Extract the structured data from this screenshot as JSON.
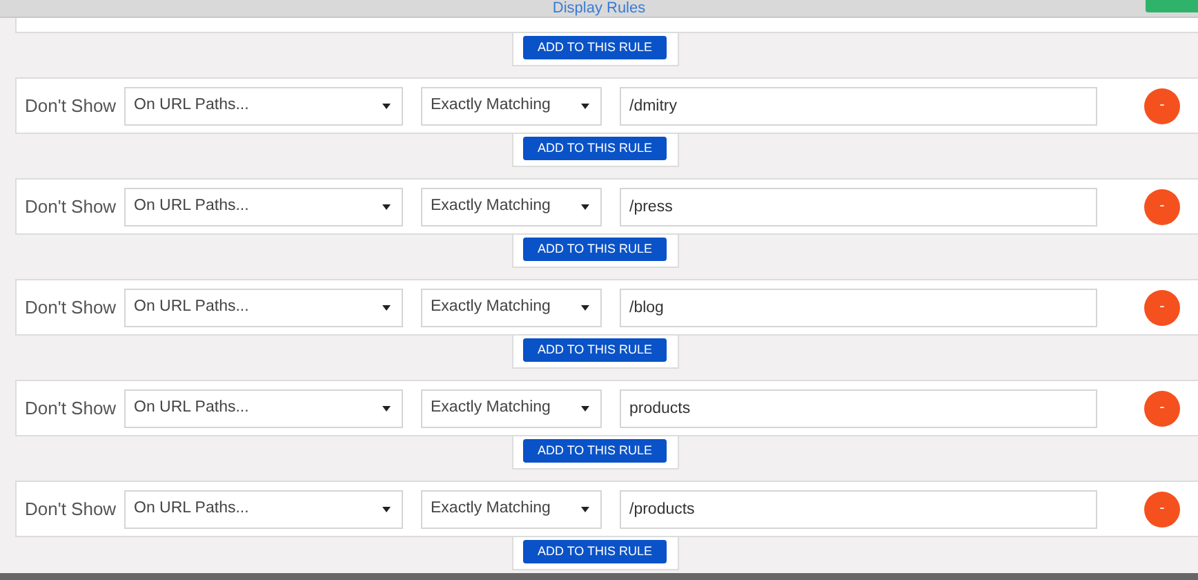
{
  "header": {
    "title": "Display Rules"
  },
  "partial_rule": {
    "add_button": "ADD TO THIS RULE"
  },
  "rules": [
    {
      "label": "Don't Show",
      "condition": "On URL Paths...",
      "match": "Exactly Matching",
      "value": "/dmitry",
      "add_button": "ADD TO THIS RULE",
      "remove_button": "-"
    },
    {
      "label": "Don't Show",
      "condition": "On URL Paths...",
      "match": "Exactly Matching",
      "value": "/press",
      "add_button": "ADD TO THIS RULE",
      "remove_button": "-"
    },
    {
      "label": "Don't Show",
      "condition": "On URL Paths...",
      "match": "Exactly Matching",
      "value": "/blog",
      "add_button": "ADD TO THIS RULE",
      "remove_button": "-"
    },
    {
      "label": "Don't Show",
      "condition": "On URL Paths...",
      "match": "Exactly Matching",
      "value": "products",
      "add_button": "ADD TO THIS RULE",
      "remove_button": "-"
    },
    {
      "label": "Don't Show",
      "condition": "On URL Paths...",
      "match": "Exactly Matching",
      "value": "/products",
      "add_button": "ADD TO THIS RULE",
      "remove_button": "-"
    }
  ]
}
